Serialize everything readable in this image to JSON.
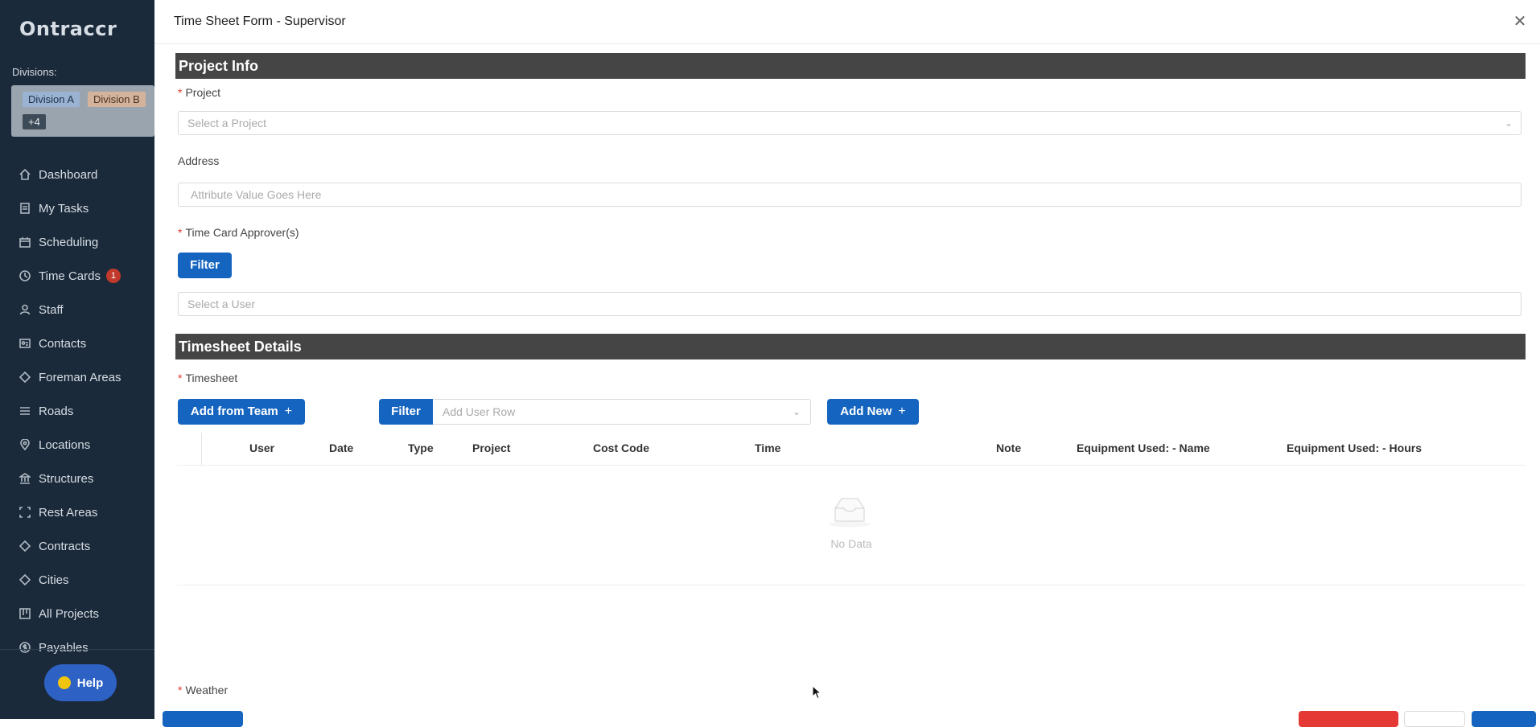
{
  "sidebar": {
    "logo": "Ontraccr",
    "divisions_label": "Divisions:",
    "divisions": [
      "Division A",
      "Division B"
    ],
    "divisions_more": "+4",
    "items": [
      {
        "label": "Dashboard",
        "icon": "home-icon"
      },
      {
        "label": "My Tasks",
        "icon": "tasks-icon"
      },
      {
        "label": "Scheduling",
        "icon": "calendar-icon"
      },
      {
        "label": "Time Cards",
        "icon": "clock-icon",
        "badge": "1"
      },
      {
        "label": "Staff",
        "icon": "user-icon"
      },
      {
        "label": "Contacts",
        "icon": "contacts-icon"
      },
      {
        "label": "Foreman Areas",
        "icon": "diamond-icon"
      },
      {
        "label": "Roads",
        "icon": "list-icon"
      },
      {
        "label": "Locations",
        "icon": "pin-icon"
      },
      {
        "label": "Structures",
        "icon": "bank-icon"
      },
      {
        "label": "Rest Areas",
        "icon": "corners-icon"
      },
      {
        "label": "Contracts",
        "icon": "diamond-icon"
      },
      {
        "label": "Cities",
        "icon": "diamond-icon"
      },
      {
        "label": "All Projects",
        "icon": "projects-icon"
      },
      {
        "label": "Payables",
        "icon": "dollar-icon"
      }
    ],
    "help_label": "Help"
  },
  "modal": {
    "title": "Time Sheet Form - Supervisor",
    "close_icon": "close-icon",
    "project_info": {
      "heading": "Project Info",
      "project_label": "Project",
      "project_placeholder": "Select a Project",
      "address_label": "Address",
      "address_placeholder": "Attribute Value Goes Here",
      "approver_label": "Time Card Approver(s)",
      "filter_label": "Filter",
      "user_placeholder": "Select a User"
    },
    "timesheet_details": {
      "heading": "Timesheet Details",
      "timesheet_label": "Timesheet",
      "add_from_team_label": "Add from Team",
      "filter_label": "Filter",
      "add_user_row_placeholder": "Add User Row",
      "add_new_label": "Add New",
      "columns": [
        "User",
        "Date",
        "Type",
        "Project",
        "Cost Code",
        "Time",
        "Note",
        "Equipment Used: - Name",
        "Equipment Used: - Hours"
      ],
      "empty_text": "No Data"
    },
    "weather_label": "Weather"
  },
  "colors": {
    "sidebar_bg": "#1b2a3a",
    "primary": "#1565c0",
    "section_bar": "#454545",
    "required": "#e0392b",
    "danger": "#e53935"
  }
}
